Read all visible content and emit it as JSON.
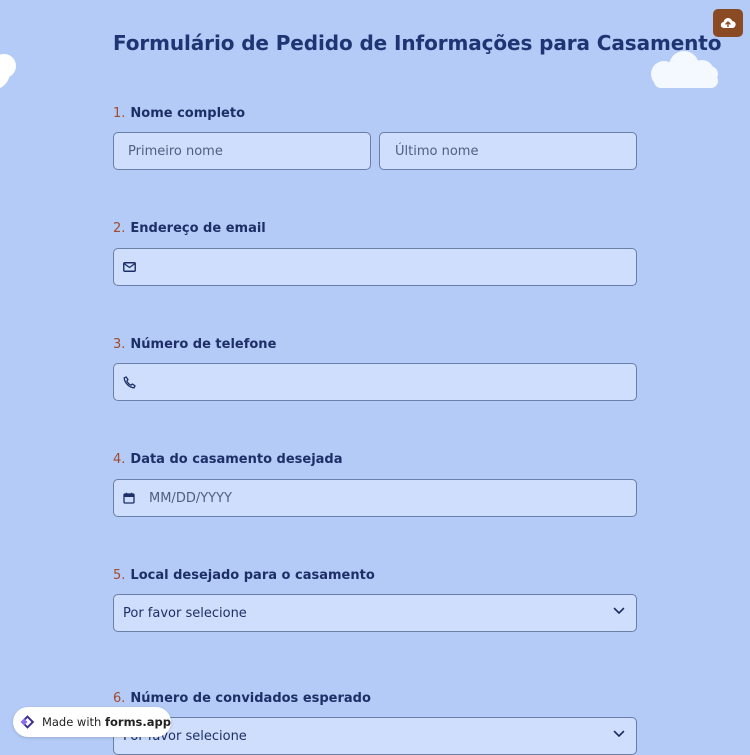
{
  "form": {
    "title": "Formulário de Pedido de Informações para Casamento",
    "questions": [
      {
        "number": "1.",
        "label": "Nome completo",
        "first_placeholder": "Primeiro nome",
        "last_placeholder": "Último nome"
      },
      {
        "number": "2.",
        "label": "Endereço de email",
        "icon": "envelope-icon"
      },
      {
        "number": "3.",
        "label": "Número de telefone",
        "icon": "phone-icon"
      },
      {
        "number": "4.",
        "label": "Data do casamento desejada",
        "placeholder": "MM/DD/YYYY",
        "icon": "calendar-icon"
      },
      {
        "number": "5.",
        "label": "Local desejado para o casamento",
        "selected": "Por favor selecione"
      },
      {
        "number": "6.",
        "label": "Número de convidados esperado",
        "selected": "Por favor selecione"
      }
    ]
  },
  "badge": {
    "prefix": "Made with",
    "brand": "forms.app"
  },
  "colors": {
    "background": "#b3cbf6",
    "field": "#cfdefc",
    "accent_number": "#a24a2c",
    "save_button": "#8a4a23"
  }
}
